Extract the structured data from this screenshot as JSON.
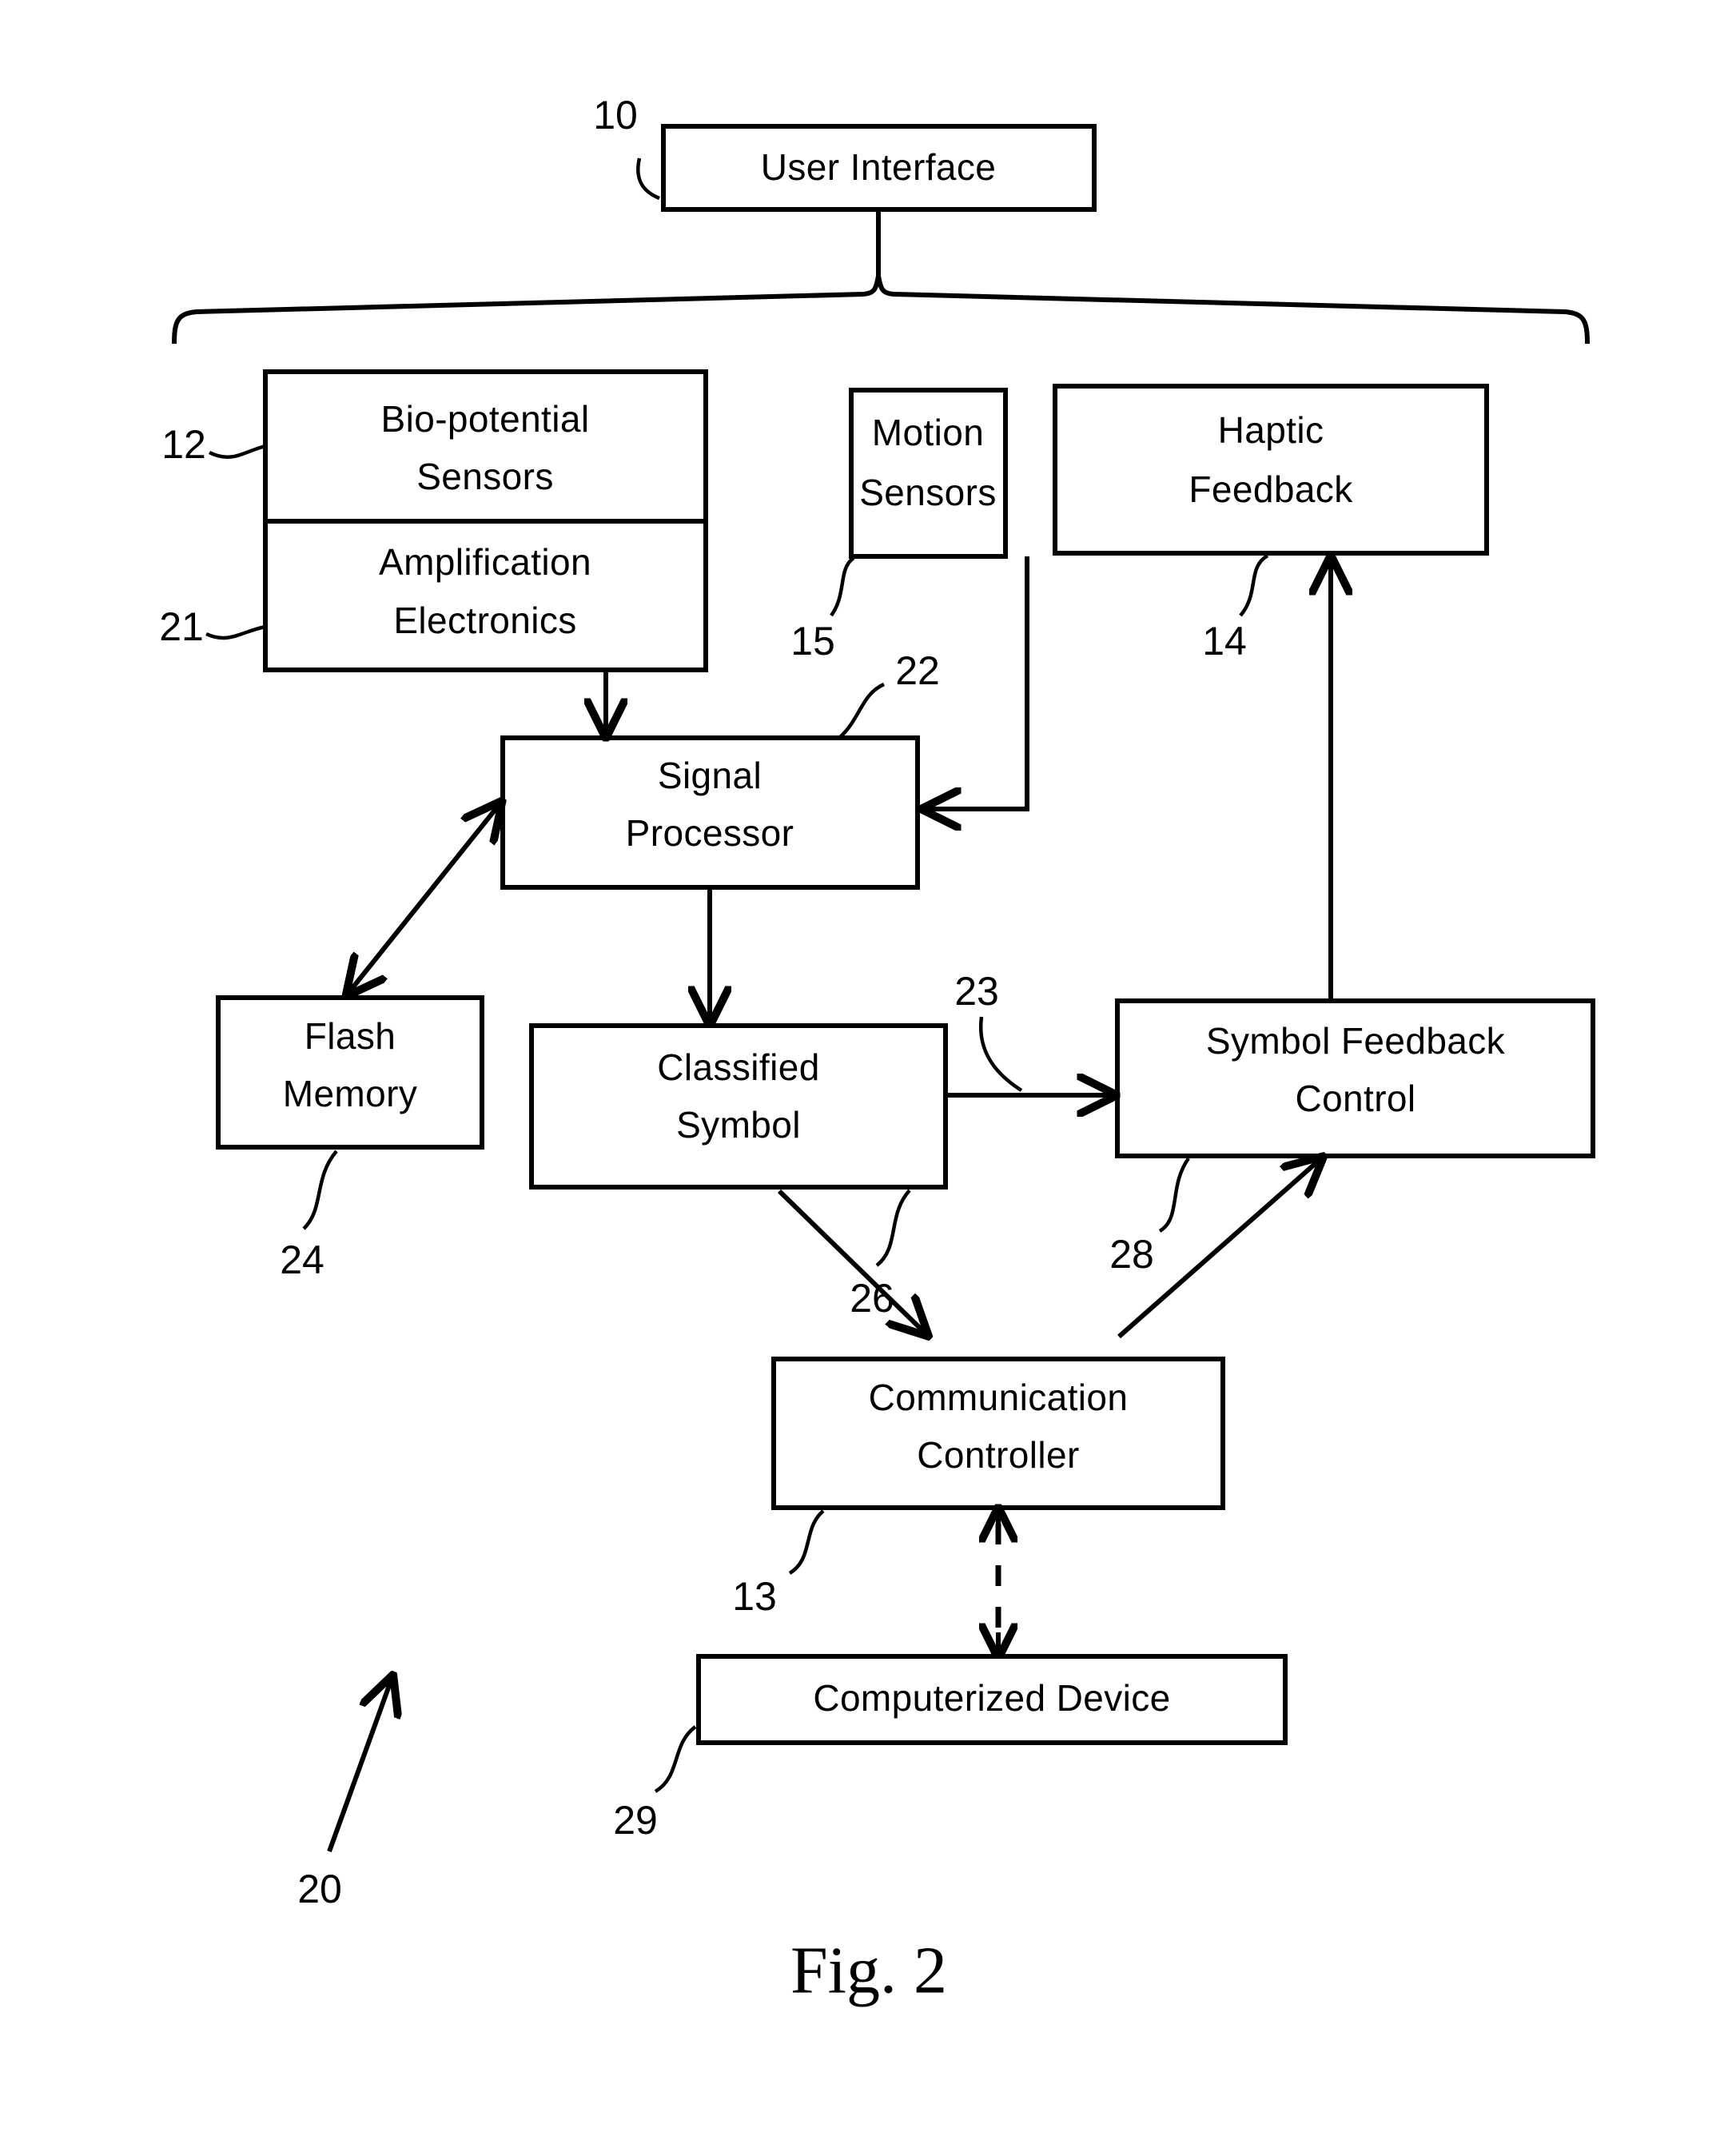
{
  "figure": {
    "caption": "Fig. 2",
    "system_ref": "20"
  },
  "blocks": [
    {
      "id": "user-interface",
      "label": "User Interface",
      "ref": "10",
      "lines": [
        "User Interface"
      ]
    },
    {
      "id": "bio-potential-sensors",
      "label": "Bio-potential Sensors",
      "ref": "12",
      "lines": [
        "Bio-potential",
        "Sensors"
      ]
    },
    {
      "id": "amplification-electronics",
      "label": "Amplification Electronics",
      "ref": "21",
      "lines": [
        "Amplification",
        "Electronics"
      ]
    },
    {
      "id": "motion-sensors",
      "label": "Motion Sensors",
      "ref": "15",
      "lines": [
        "Motion",
        "Sensors"
      ]
    },
    {
      "id": "haptic-feedback",
      "label": "Haptic Feedback",
      "ref": "14",
      "lines": [
        "Haptic",
        "Feedback"
      ]
    },
    {
      "id": "signal-processor",
      "label": "Signal Processor",
      "ref": "22",
      "lines": [
        "Signal",
        "Processor"
      ]
    },
    {
      "id": "flash-memory",
      "label": "Flash Memory",
      "ref": "24",
      "lines": [
        "Flash",
        "Memory"
      ]
    },
    {
      "id": "classified-symbol",
      "label": "Classified Symbol",
      "ref": "26",
      "lines": [
        "Classified",
        "Symbol"
      ]
    },
    {
      "id": "symbol-feedback-control",
      "label": "Symbol Feedback Control",
      "ref": "28",
      "lines": [
        "Symbol Feedback",
        "Control"
      ]
    },
    {
      "id": "communication-controller",
      "label": "Communication Controller",
      "ref": "13",
      "lines": [
        "Communication",
        "Controller"
      ]
    },
    {
      "id": "computerized-device",
      "label": "Computerized Device",
      "ref": "29",
      "lines": [
        "Computerized Device"
      ]
    }
  ],
  "connector_refs": [
    {
      "id": "classified-to-feedback",
      "ref": "23"
    }
  ],
  "refs": {
    "user_interface": "10",
    "bio_potential_sensors": "12",
    "communication_controller": "13",
    "haptic_feedback": "14",
    "motion_sensors": "15",
    "system": "20",
    "amplification_electronics": "21",
    "signal_processor": "22",
    "classified_symbol_link": "23",
    "flash_memory": "24",
    "classified_symbol": "26",
    "symbol_feedback_control": "28",
    "computerized_device": "29"
  },
  "colors": {
    "ink": "#000000",
    "paper": "#ffffff"
  }
}
